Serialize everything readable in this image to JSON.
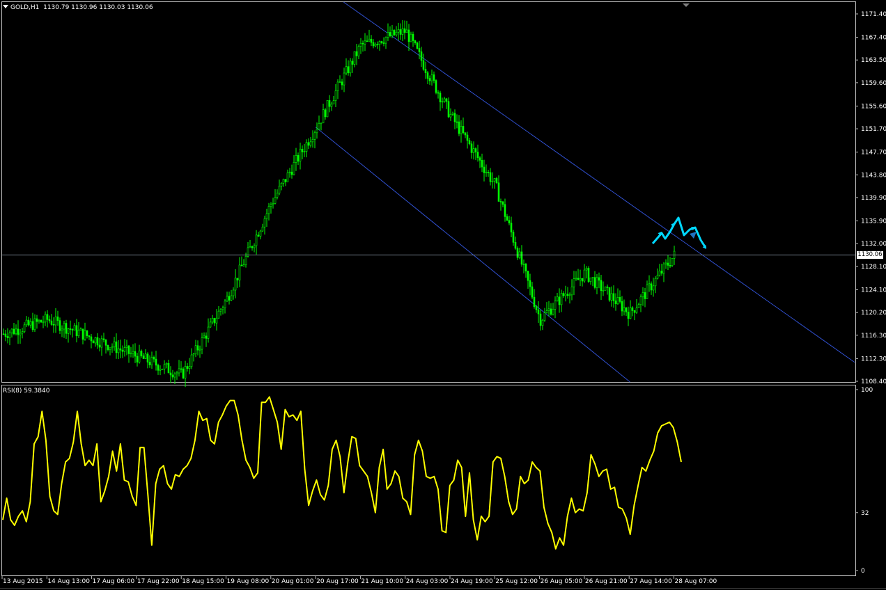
{
  "header": {
    "symbol": "GOLD,H1",
    "ohlc": "1130.79 1130.96 1130.03 1130.06"
  },
  "price_axis": {
    "ticks": [
      "1171.40",
      "1167.40",
      "1163.50",
      "1159.60",
      "1155.60",
      "1151.70",
      "1147.70",
      "1143.80",
      "1139.90",
      "1135.90",
      "1132.00",
      "1128.10",
      "1124.10",
      "1120.20",
      "1116.30",
      "1112.30",
      "1108.40"
    ],
    "current_price": "1130.06"
  },
  "rsi_panel": {
    "label": "RSI(8) 59.3840",
    "levels": [
      "100",
      "32",
      "0"
    ]
  },
  "time_axis": {
    "labels": [
      "13 Aug 2015",
      "14 Aug 13:00",
      "17 Aug 06:00",
      "17 Aug 22:00",
      "18 Aug 15:00",
      "19 Aug 08:00",
      "20 Aug 01:00",
      "20 Aug 17:00",
      "21 Aug 10:00",
      "24 Aug 03:00",
      "24 Aug 19:00",
      "25 Aug 12:00",
      "26 Aug 05:00",
      "26 Aug 21:00",
      "27 Aug 14:00",
      "28 Aug 07:00"
    ]
  },
  "colors": {
    "background": "#000000",
    "candles": "#00ff00",
    "candle_body": "#000000",
    "channel": "#3050d0",
    "rsi_line": "#ffff00",
    "arrows": "#00d8ff",
    "grid_frame": "#c0c0c0"
  },
  "chart_data": [
    {
      "type": "candlestick",
      "title": "GOLD,H1",
      "ylim": [
        1108.4,
        1171.4
      ],
      "key_points": [
        {
          "x": "13 Aug 2015",
          "price": 1116.5
        },
        {
          "x": "14 Aug 13:00",
          "price": 1119.0
        },
        {
          "x": "18 Aug 15:00",
          "price": 1109.5
        },
        {
          "x": "19 Aug 08:00",
          "price": 1122.5
        },
        {
          "x": "20 Aug 01:00",
          "price": 1139.0
        },
        {
          "x": "20 Aug 17:00",
          "price": 1152.0
        },
        {
          "x": "21 Aug 10:00",
          "price": 1166.0
        },
        {
          "x": "24 Aug 03:00",
          "price": 1168.5
        },
        {
          "x": "24 Aug 19:00",
          "price": 1154.0
        },
        {
          "x": "25 Aug 12:00",
          "price": 1142.0
        },
        {
          "x": "26 Aug 05:00",
          "price": 1119.0
        },
        {
          "x": "26 Aug 21:00",
          "price": 1127.0
        },
        {
          "x": "27 Aug 14:00",
          "price": 1120.0
        },
        {
          "x": "28 Aug 07:00",
          "price": 1130.06
        }
      ],
      "channel": {
        "upper": [
          {
            "x": "21 Aug 10:00",
            "price": 1171.4
          },
          {
            "x": "28 Aug 07:00",
            "price": 1133.5
          }
        ],
        "lower": [
          {
            "x": "20 Aug 17:00",
            "price": 1152.0
          },
          {
            "x": "27 Aug 14:00",
            "price": 1108.4
          }
        ]
      }
    },
    {
      "type": "line",
      "title": "RSI(8) 59.3840",
      "ylim": [
        0,
        100
      ],
      "levels": [
        32
      ],
      "series": [
        {
          "name": "RSI(8)",
          "values": [
            28,
            40,
            28,
            25,
            30,
            33,
            27,
            38,
            70,
            74,
            88,
            72,
            41,
            33,
            31,
            48,
            60,
            62,
            71,
            88,
            70,
            58,
            61,
            58,
            70,
            38,
            44,
            52,
            66,
            55,
            70,
            50,
            49,
            41,
            36,
            68,
            68,
            42,
            14,
            48,
            56,
            58,
            48,
            45,
            53,
            52,
            56,
            58,
            62,
            72,
            88,
            83,
            84,
            72,
            70,
            82,
            86,
            91,
            94,
            94,
            86,
            72,
            61,
            57,
            51,
            54,
            93,
            93,
            96,
            89,
            82,
            67,
            89,
            85,
            86,
            83,
            88,
            56,
            36,
            44,
            50,
            42,
            39,
            47,
            67,
            72,
            63,
            43,
            60,
            74,
            73,
            58,
            55,
            52,
            43,
            32,
            57,
            67,
            45,
            48,
            55,
            52,
            40,
            38,
            31,
            64,
            72,
            66,
            52,
            51,
            52,
            45,
            22,
            21,
            47,
            50,
            61,
            57,
            30,
            54,
            28,
            17,
            30,
            27,
            30,
            60,
            63,
            62,
            52,
            38,
            31,
            34,
            52,
            48,
            50,
            60,
            57,
            55,
            35,
            26,
            21,
            12,
            18,
            14,
            30,
            40,
            32,
            34,
            33,
            43,
            64,
            59,
            52,
            55,
            56,
            45,
            46,
            35,
            34,
            29,
            20,
            36,
            47,
            57,
            55,
            61,
            66,
            76,
            80,
            81,
            82,
            79,
            71,
            60
          ]
        }
      ]
    }
  ]
}
